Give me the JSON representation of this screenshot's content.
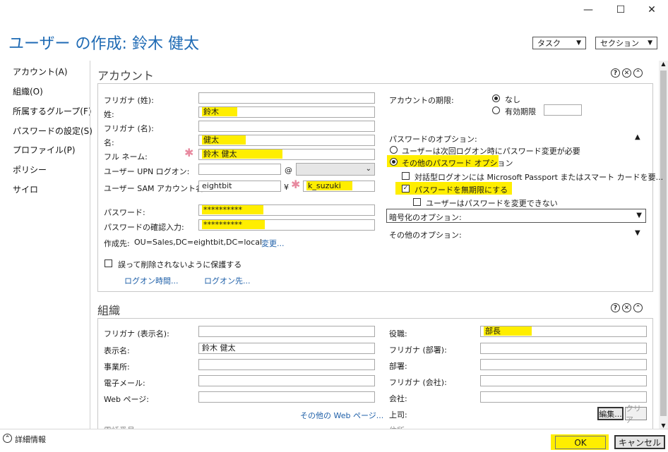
{
  "window": {
    "title": "ユーザー の作成: 鈴木 健太",
    "minimize": "—",
    "maximize": "☐",
    "close": "✕"
  },
  "toolbar": {
    "task_label": "タスク",
    "section_label": "セクション"
  },
  "nav": {
    "items": [
      {
        "label": "アカウント(A)"
      },
      {
        "label": "組織(O)"
      },
      {
        "label": "所属するグループ(F)"
      },
      {
        "label": "パスワードの設定(S)"
      },
      {
        "label": "プロファイル(P)"
      },
      {
        "label": "ポリシー"
      },
      {
        "label": "サイロ"
      }
    ]
  },
  "account": {
    "header": "アカウント",
    "furigana_sei": {
      "label": "フリガナ (姓):",
      "value": ""
    },
    "sei": {
      "label": "姓:",
      "value": "鈴木"
    },
    "furigana_mei": {
      "label": "フリガナ (名):",
      "value": ""
    },
    "mei": {
      "label": "名:",
      "value": "健太"
    },
    "fullname": {
      "label": "フル ネーム:",
      "value": "鈴木 健太"
    },
    "upn": {
      "label": "ユーザー UPN ログオン:",
      "value": "",
      "at": "@",
      "domain": ""
    },
    "sam": {
      "label": "ユーザー SAM アカウント名...",
      "domain": "eightbit",
      "sep": "¥",
      "value": "k_suzuki"
    },
    "password": {
      "label": "パスワード:",
      "value": "**********"
    },
    "password_confirm": {
      "label": "パスワードの確認入力:",
      "value": "**********"
    },
    "created_in": {
      "label": "作成先:",
      "value": "OU=Sales,DC=eightbit,DC=local",
      "change": "変更..."
    },
    "protect": {
      "label": "誤って削除されないように保護する",
      "checked": false
    },
    "logon_hours": "ログオン時間...",
    "logon_to": "ログオン先...",
    "expiry": {
      "label": "アカウントの期限:",
      "never": "なし",
      "end_of": "有効期限",
      "end_value": ""
    },
    "pw_options": {
      "label": "パスワードのオプション:",
      "must_change": "ユーザーは次回ログオン時にパスワード変更が必要",
      "other": "その他のパスワード オプション",
      "smartcard": "対話型ログオンには Microsoft Passport またはスマート カードを要...",
      "never_expires": "パスワードを無期限にする",
      "cannot_change": "ユーザーはパスワードを変更できない"
    },
    "encryption": "暗号化のオプション:",
    "other_options": "その他のオプション:"
  },
  "org": {
    "header": "組織",
    "furigana_display": {
      "label": "フリガナ (表示名):",
      "value": ""
    },
    "display": {
      "label": "表示名:",
      "value": "鈴木 健太"
    },
    "office": {
      "label": "事業所:",
      "value": ""
    },
    "email": {
      "label": "電子メール:",
      "value": ""
    },
    "web": {
      "label": "Web ページ:",
      "value": ""
    },
    "other_web": "その他の Web ページ...",
    "title": {
      "label": "役職:",
      "value": "部長"
    },
    "furigana_dept": {
      "label": "フリガナ (部署):",
      "value": ""
    },
    "dept": {
      "label": "部署:",
      "value": ""
    },
    "furigana_company": {
      "label": "フリガナ (会社):",
      "value": ""
    },
    "company": {
      "label": "会社:",
      "value": ""
    },
    "manager": {
      "label": "上司:",
      "edit": "編集...",
      "clear": "クリア"
    },
    "phone_partial": "電話番号",
    "address_partial": "住所:"
  },
  "footer": {
    "details": "詳細情報",
    "ok": "OK",
    "cancel": "キャンセル"
  },
  "colors": {
    "accent": "#1e6ab4",
    "highlight": "#ffee00",
    "link": "#1e5fa8"
  }
}
